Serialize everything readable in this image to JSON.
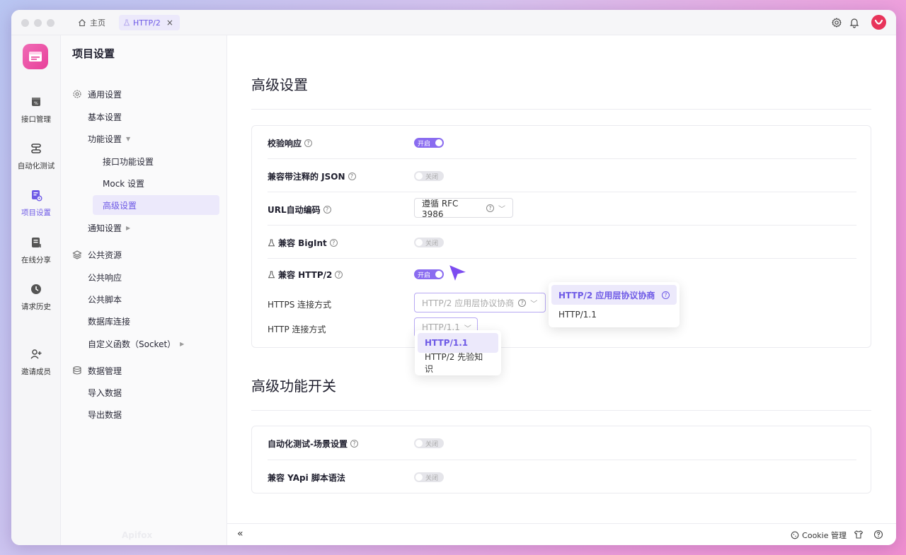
{
  "tabs": {
    "home_label": "主页",
    "active_label": "HTTP/2",
    "close_glyph": "×"
  },
  "rail": {
    "items": [
      {
        "label": "接口管理",
        "icon": "api-icon"
      },
      {
        "label": "自动化测试",
        "icon": "automation-icon"
      },
      {
        "label": "项目设置",
        "icon": "settings-doc-icon"
      },
      {
        "label": "在线分享",
        "icon": "share-doc-icon"
      },
      {
        "label": "请求历史",
        "icon": "history-icon"
      },
      {
        "label": "邀请成员",
        "icon": "invite-user-icon"
      }
    ],
    "active_index": 2
  },
  "nav": {
    "title": "项目设置",
    "general": "通用设置",
    "basic": "基本设置",
    "features": "功能设置",
    "api_features": "接口功能设置",
    "mock": "Mock 设置",
    "advanced": "高级设置",
    "notify": "通知设置",
    "public": "公共资源",
    "public_response": "公共响应",
    "public_script": "公共脚本",
    "db_conn": "数据库连接",
    "custom_func": "自定义函数（Socket）",
    "data_mgmt": "数据管理",
    "import": "导入数据",
    "export": "导出数据",
    "watermark": "Apifox"
  },
  "main": {
    "section1_title": "高级设置",
    "section2_title": "高级功能开关",
    "rows": {
      "validate_response": "校验响应",
      "json_comments": "兼容带注释的 JSON",
      "url_encode": "URL自动编码",
      "bigint": "兼容 BigInt",
      "http2": "兼容 HTTP/2",
      "https_conn": "HTTPS 连接方式",
      "http_conn": "HTTP 连接方式",
      "auto_scene": "自动化测试-场景设置",
      "yapi": "兼容 YApi 脚本语法"
    },
    "toggle_on": "开启",
    "toggle_off": "关闭",
    "url_encode_value": "遵循 RFC 3986",
    "https_value": "HTTP/2 应用层协议协商",
    "http_value": "HTTP/1.1"
  },
  "https_dropdown": {
    "options": [
      "HTTP/2 应用层协议协商",
      "HTTP/1.1"
    ],
    "selected": 0
  },
  "http_dropdown": {
    "options": [
      "HTTP/1.1",
      "HTTP/2 先验知识"
    ],
    "selected": 0
  },
  "bottombar": {
    "collapse": "«",
    "cookie": "Cookie 管理"
  },
  "colors": {
    "accent": "#6e5ae6",
    "toggle_on": "#8a6cf0",
    "avatar": "#e8345a",
    "logo": "#e8409a"
  }
}
